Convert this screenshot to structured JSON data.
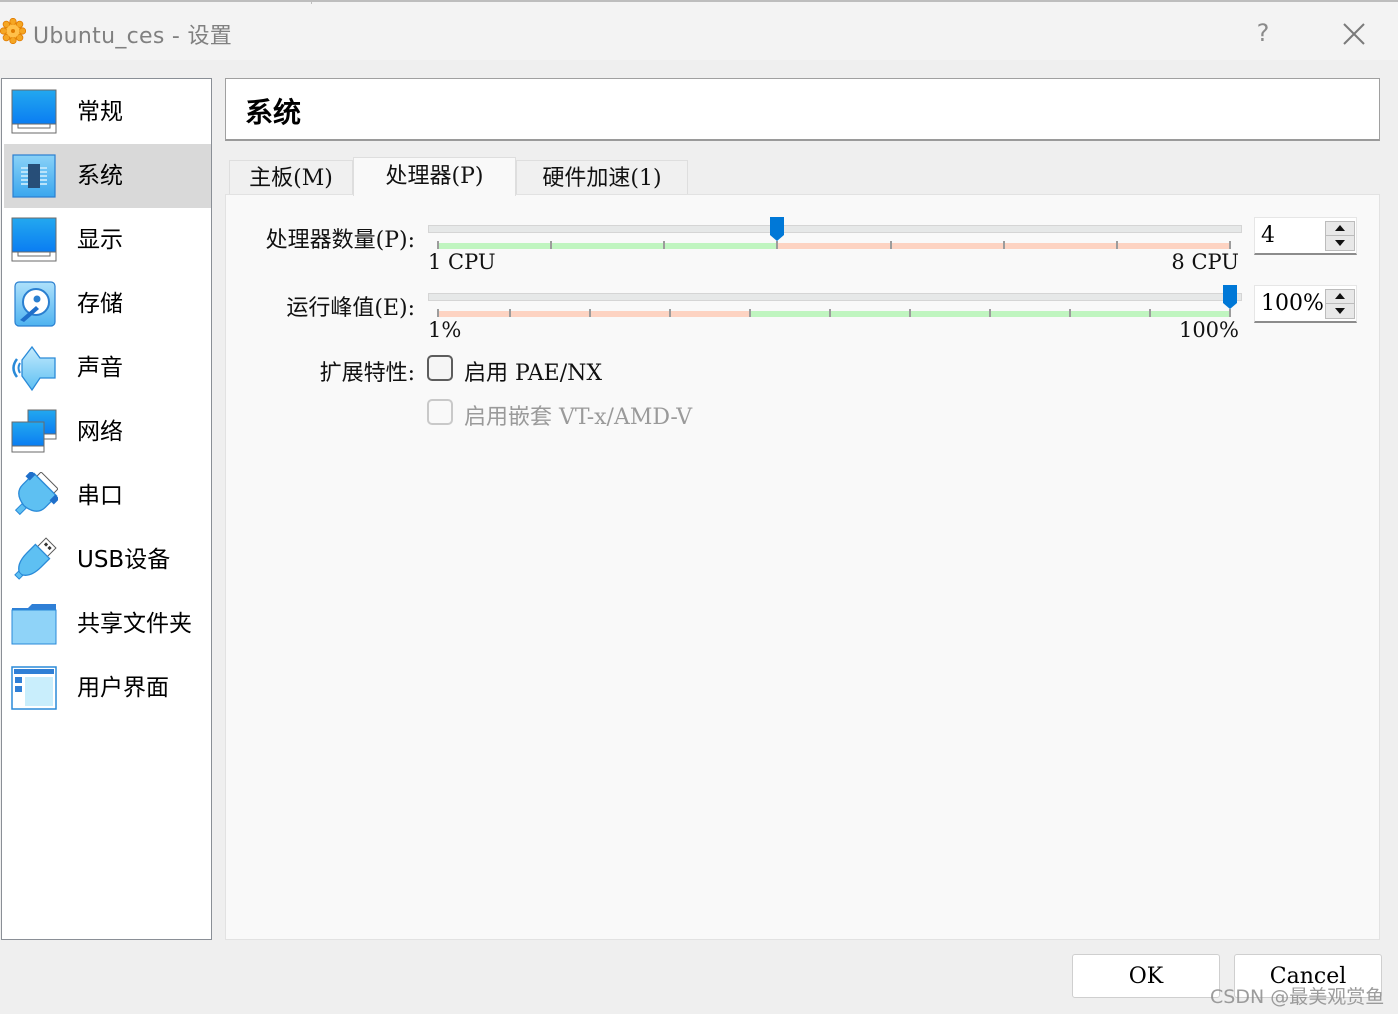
{
  "window": {
    "title": "Ubuntu_ces - 设置",
    "help_label": "?",
    "close_label": "close"
  },
  "sidebar": {
    "items": [
      {
        "label": "常规",
        "icon": "general-monitor-icon",
        "selected": false
      },
      {
        "label": "系统",
        "icon": "system-chip-icon",
        "selected": true
      },
      {
        "label": "显示",
        "icon": "display-monitor-icon",
        "selected": false
      },
      {
        "label": "存储",
        "icon": "storage-disk-icon",
        "selected": false
      },
      {
        "label": "声音",
        "icon": "audio-speaker-icon",
        "selected": false
      },
      {
        "label": "网络",
        "icon": "network-monitors-icon",
        "selected": false
      },
      {
        "label": "串口",
        "icon": "serial-port-icon",
        "selected": false
      },
      {
        "label": "USB设备",
        "icon": "usb-plug-icon",
        "selected": false
      },
      {
        "label": "共享文件夹",
        "icon": "shared-folder-icon",
        "selected": false
      },
      {
        "label": "用户界面",
        "icon": "user-interface-icon",
        "selected": false
      }
    ]
  },
  "page": {
    "title": "系统",
    "tabs": [
      {
        "label": "主板(M)",
        "active": false
      },
      {
        "label": "处理器(P)",
        "active": true
      },
      {
        "label": "硬件加速(1)",
        "active": false
      }
    ]
  },
  "processor": {
    "cpu_count": {
      "label": "处理器数量(P):",
      "min": 1,
      "max": 8,
      "value": 4,
      "recommended_max": 4,
      "min_label": "1 CPU",
      "max_label": "8 CPU",
      "spin_value": "4"
    },
    "execution_cap": {
      "label": "运行峰值(E):",
      "min": 1,
      "max": 100,
      "value": 100,
      "recommended_min": 40,
      "min_label": "1%",
      "max_label": "100%",
      "spin_value": "100%"
    },
    "extended_features": {
      "label": "扩展特性:",
      "options": [
        {
          "label": "启用 PAE/NX",
          "checked": false,
          "enabled": true
        },
        {
          "label": "启用嵌套 VT-x/AMD-V",
          "checked": false,
          "enabled": false
        }
      ]
    }
  },
  "footer": {
    "ok_label": "OK",
    "cancel_label": "Cancel",
    "watermark": "CSDN @最美观赏鱼"
  },
  "colors": {
    "accent": "#0078d7",
    "slider_ok": "#c0f5c0",
    "slider_warn": "#fdd3c2",
    "selected_bg": "#d9d9d9"
  }
}
